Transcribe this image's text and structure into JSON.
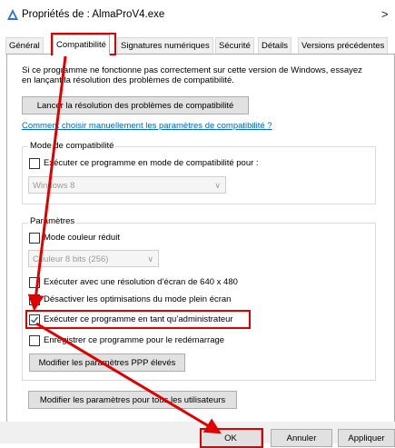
{
  "window": {
    "title": "Propriétés de : AlmaProV4.exe",
    "close_glyph": ">"
  },
  "tabs": [
    {
      "label": "Général"
    },
    {
      "label": "Compatibilité"
    },
    {
      "label": "Signatures numériques"
    },
    {
      "label": "Sécurité"
    },
    {
      "label": "Détails"
    },
    {
      "label": "Versions précédentes"
    }
  ],
  "intro": {
    "text": "Si ce programme ne fonctionne pas correctement sur cette version de Windows, essayez en lançant la résolution des problèmes de compatibilité."
  },
  "troubleshoot_button": "Lancer la résolution des problèmes de compatibilité",
  "manual_link": "Comment choisir manuellement les paramètres de compatibilité ?",
  "compat_mode": {
    "group_label": "Mode de compatibilité",
    "checkbox_label": "Exécuter ce programme en mode de compatibilité pour :",
    "checked": false,
    "select_value": "Windows 8"
  },
  "parametres": {
    "group_label": "Paramètres",
    "reduced_color": {
      "label": "Mode couleur réduit",
      "checked": false
    },
    "color_select": "Couleur 8 bits (256)",
    "low_res": {
      "label": "Exécuter avec une résolution d’écran de 640 x 480",
      "checked": false
    },
    "fullscreen_opt": {
      "label": "Désactiver les optimisations du mode plein écran",
      "checked": false
    },
    "run_admin": {
      "label": "Exécuter ce programme en tant qu’administrateur",
      "checked": true
    },
    "register_restart": {
      "label": "Enregistrer ce programme pour le redémarrage",
      "checked": false
    },
    "dpi_button": "Modifier les paramètres PPP élevés"
  },
  "all_users_button": "Modifier les paramètres pour tous les utilisateurs",
  "footer": {
    "ok": "OK",
    "cancel": "Annuler",
    "apply": "Appliquer"
  },
  "colors": {
    "annotation_red": "#e10000",
    "link_blue": "#0066cc",
    "check_blue": "#1a5fb4"
  }
}
